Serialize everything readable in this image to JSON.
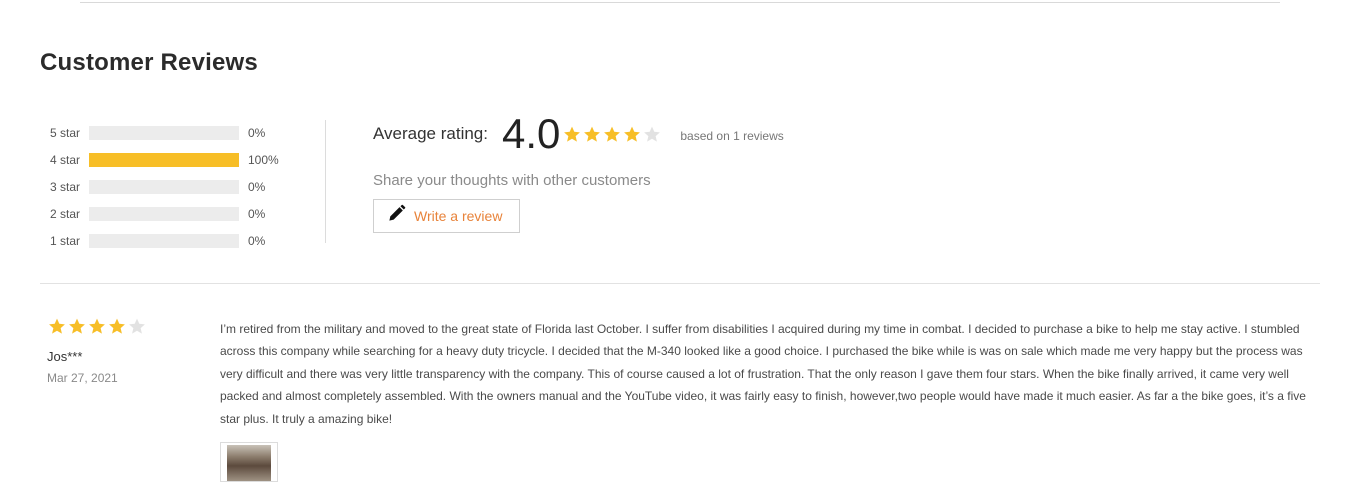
{
  "reviews_section": {
    "title": "Customer Reviews",
    "distribution": [
      {
        "label": "5 star",
        "percent_text": "0%",
        "fill": 0.0
      },
      {
        "label": "4 star",
        "percent_text": "100%",
        "fill": 1.0
      },
      {
        "label": "3 star",
        "percent_text": "0%",
        "fill": 0.0
      },
      {
        "label": "2 star",
        "percent_text": "0%",
        "fill": 0.0
      },
      {
        "label": "1 star",
        "percent_text": "0%",
        "fill": 0.0
      }
    ],
    "average": {
      "label": "Average rating:",
      "value": "4.0",
      "stars_filled": 4,
      "stars_total": 5,
      "based_on": "based on 1 reviews"
    },
    "share_prompt": "Share your thoughts with other customers",
    "write_button": {
      "label": "Write a review",
      "icon": "pencil-icon"
    },
    "colors": {
      "star": "#f7be27",
      "star_empty": "#e2e2e2",
      "bar_fill": "#f7be27",
      "bar_track": "#ececec",
      "accent": "#e8833a"
    }
  },
  "review": {
    "stars_filled": 4,
    "stars_total": 5,
    "author": "Jos***",
    "date": "Mar 27, 2021",
    "text": "I’m retired from the military and moved to the great state of Florida last October. I suffer from disabilities I acquired during my time in combat. I decided to purchase a bike to help me stay active. I stumbled across this company while searching for a heavy duty tricycle. I decided that the M-340 looked like a good choice. I purchased the bike while is was on sale which made me very happy but the process was very difficult and there was very little transparency with the company. This of course caused a lot of frustration. That the only reason I gave them four stars. When the bike finally arrived, it came very well packed and almost completely assembled. With the owners manual and the YouTube video, it was fairly easy to finish, however,two people would have made it much easier. As far a the bike goes, it’s a five star plus. It truly a amazing bike!"
  }
}
